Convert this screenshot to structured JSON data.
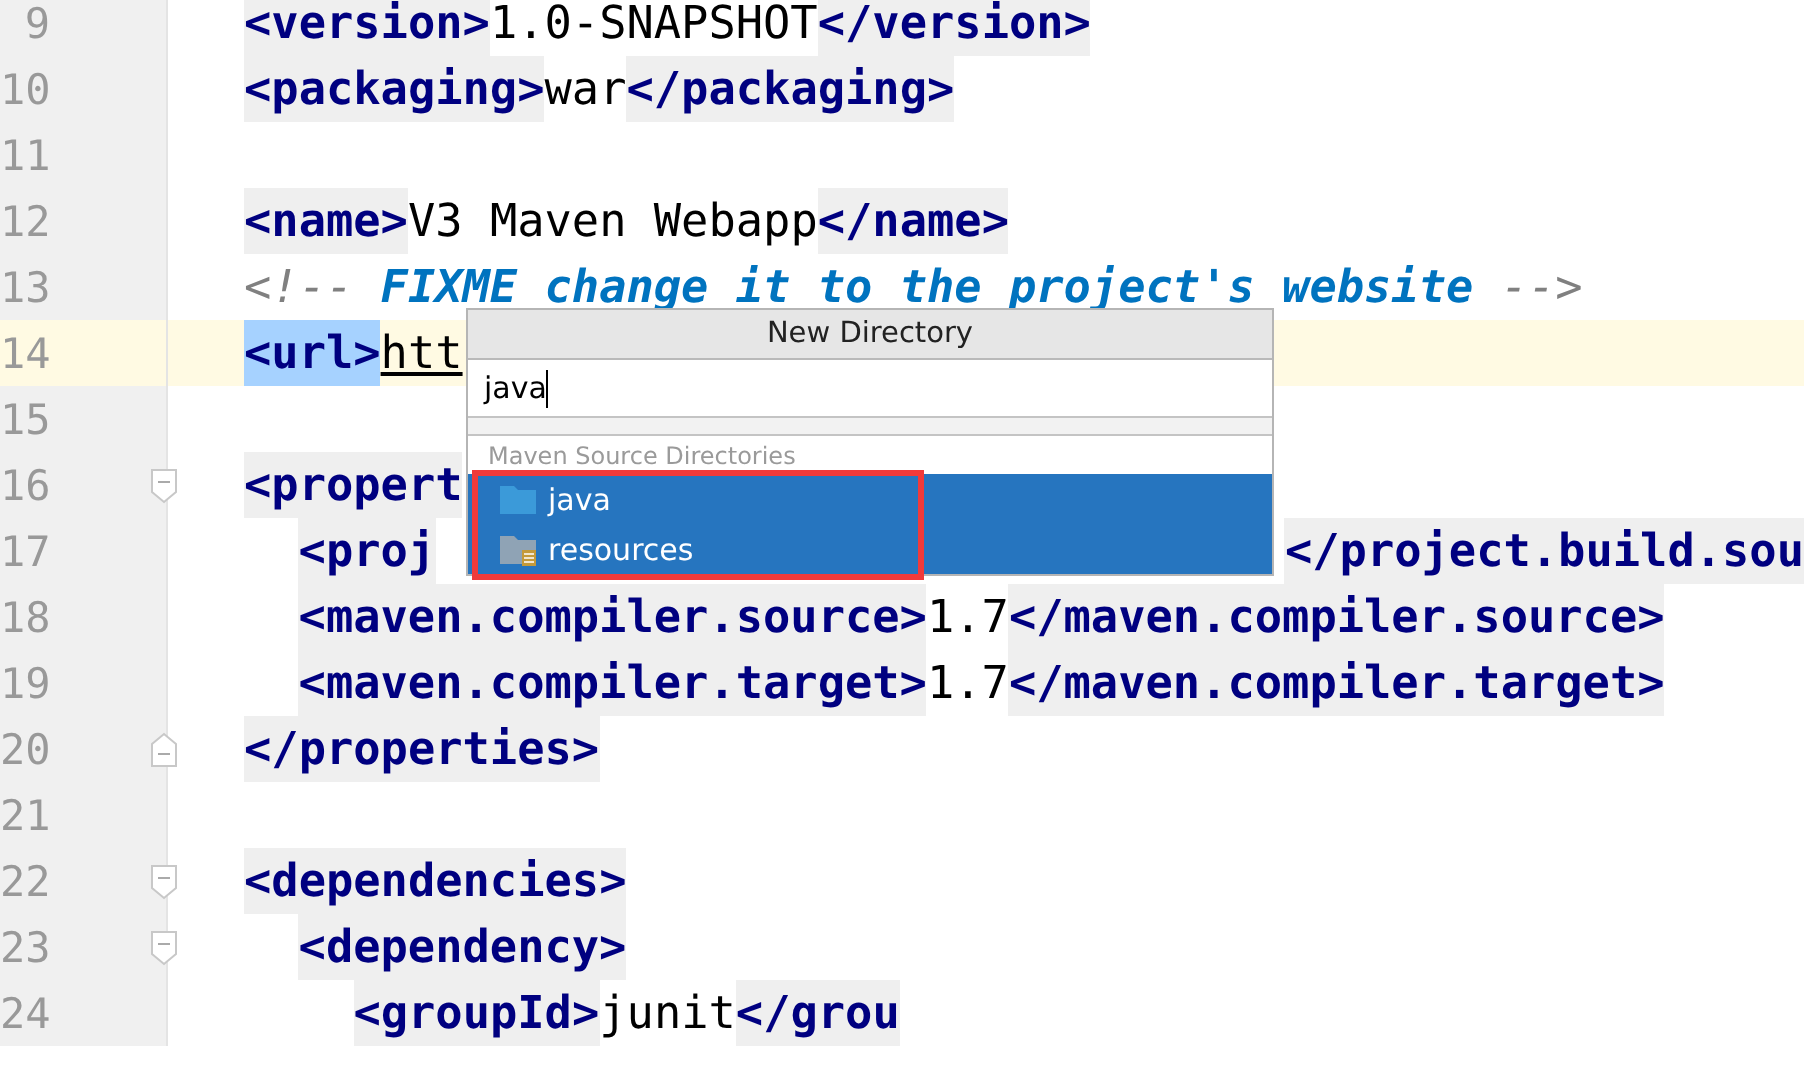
{
  "editor": {
    "lines": [
      {
        "number": "9",
        "current": false,
        "kind": "outer",
        "tokens": [
          {
            "kind": "tag",
            "text": "<version>"
          },
          {
            "kind": "text",
            "text": "1.0-SNAPSHOT"
          },
          {
            "kind": "tag",
            "text": "</version>"
          }
        ]
      },
      {
        "number": "10",
        "current": false,
        "kind": "outer",
        "tokens": [
          {
            "kind": "tag",
            "text": "<packaging>"
          },
          {
            "kind": "text",
            "text": "war"
          },
          {
            "kind": "tag",
            "text": "</packaging>"
          }
        ]
      },
      {
        "number": "11",
        "current": false,
        "kind": "outer"
      },
      {
        "number": "12",
        "current": false,
        "kind": "outer",
        "tokens": [
          {
            "kind": "tag",
            "text": "<name>"
          },
          {
            "kind": "text",
            "text": "V3 Maven Webapp"
          },
          {
            "kind": "tag",
            "text": "</name>"
          }
        ]
      },
      {
        "number": "13",
        "current": false,
        "kind": "outer",
        "tokens": [
          {
            "kind": "comment",
            "text": "<!-- "
          },
          {
            "kind": "todo",
            "text": "FIXME change it to the project's website"
          },
          {
            "kind": "comment",
            "text": " -->"
          }
        ]
      },
      {
        "number": "14",
        "current": true,
        "kind": "outer",
        "tokens": [
          {
            "kind": "selected",
            "text": "<url>"
          },
          {
            "kind": "link",
            "text": "htt"
          }
        ]
      },
      {
        "number": "15",
        "current": false,
        "kind": "outer"
      },
      {
        "number": "16",
        "current": false,
        "kind": "outer",
        "fold_start": true,
        "tokens": [
          {
            "kind": "tag",
            "text": "<propert"
          }
        ]
      },
      {
        "number": "17",
        "current": false,
        "kind": "inner",
        "tokens": [
          {
            "kind": "tag",
            "text": "<proj"
          }
        ],
        "tail": [
          {
            "kind": "tag",
            "text": "</project.build.sou"
          }
        ]
      },
      {
        "number": "18",
        "current": false,
        "kind": "inner",
        "tokens": [
          {
            "kind": "tag",
            "text": "<maven.compiler.source>"
          },
          {
            "kind": "text",
            "text": "1.7"
          },
          {
            "kind": "tag",
            "text": "</maven.compiler.source>"
          }
        ]
      },
      {
        "number": "19",
        "current": false,
        "kind": "inner",
        "tokens": [
          {
            "kind": "tag",
            "text": "<maven.compiler.target>"
          },
          {
            "kind": "text",
            "text": "1.7"
          },
          {
            "kind": "tag",
            "text": "</maven.compiler.target>"
          }
        ]
      },
      {
        "number": "20",
        "current": false,
        "kind": "outer",
        "fold_end": true,
        "tokens": [
          {
            "kind": "tag",
            "text": "</properties>"
          }
        ]
      },
      {
        "number": "21",
        "current": false,
        "kind": "outer"
      },
      {
        "number": "22",
        "current": false,
        "kind": "outer",
        "fold_start": true,
        "tokens": [
          {
            "kind": "tag",
            "text": "<dependencies>"
          }
        ]
      },
      {
        "number": "23",
        "current": false,
        "kind": "inner",
        "fold_start": true,
        "tokens": [
          {
            "kind": "tag",
            "text": "<dependency>"
          }
        ]
      },
      {
        "number": "24",
        "current": false,
        "kind": "innermost",
        "tokens": [
          {
            "kind": "tag",
            "text": "<groupId>"
          },
          {
            "kind": "text",
            "text": "junit"
          },
          {
            "kind": "tag",
            "text": "</grou"
          }
        ]
      }
    ]
  },
  "popup": {
    "title": "New Directory",
    "value": "java",
    "section": "Maven Source Directories",
    "items": [
      {
        "label": "java",
        "kind": "source",
        "selected": true
      },
      {
        "label": "resources",
        "kind": "resources",
        "selected": true
      }
    ],
    "highlight_frame": true
  }
}
